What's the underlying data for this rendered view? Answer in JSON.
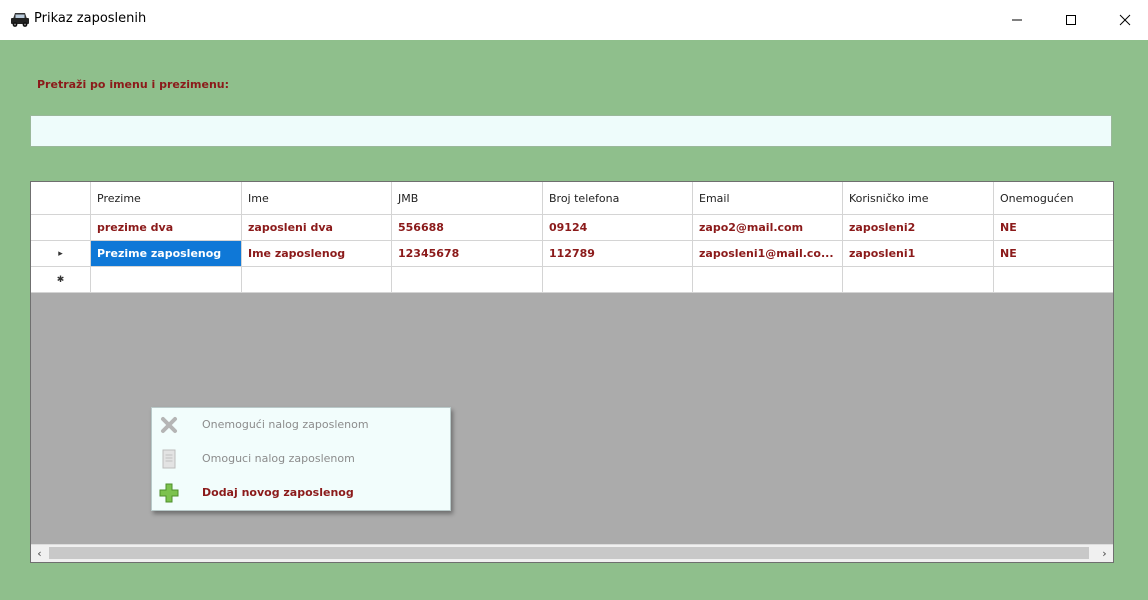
{
  "window": {
    "title": "Prikaz zaposlenih",
    "icon": "car-icon",
    "controls": [
      "minimize-icon",
      "maximize-icon",
      "close-icon"
    ]
  },
  "search": {
    "label": "Pretraži po imenu i prezimenu:",
    "value": "",
    "placeholder": ""
  },
  "grid": {
    "columns": [
      "Prezime",
      "Ime",
      "JMB",
      "Broj telefona",
      "Email",
      "Korisničko ime",
      "Onemogućen"
    ],
    "rows": [
      {
        "indicator": "",
        "cells": [
          "prezime dva",
          "zaposleni dva",
          "556688",
          "09124",
          "zapo2@mail.com",
          "zaposleni2",
          "NE"
        ]
      },
      {
        "indicator": "▸",
        "cells": [
          "Prezime zaposlenog",
          "Ime zaposlenog",
          "12345678",
          "112789",
          "zaposleni1@mail.co...",
          "zaposleni1",
          "NE"
        ]
      },
      {
        "indicator": "✱",
        "cells": [
          "",
          "",
          "",
          "",
          "",
          "",
          ""
        ]
      }
    ],
    "selected_cell": {
      "row": 1,
      "col": 0
    },
    "scroll_left_arrow": "‹",
    "scroll_right_arrow": "›"
  },
  "context_menu": {
    "items": [
      {
        "label": "Onemogući nalog zaposlenom",
        "icon": "x-icon",
        "enabled": false
      },
      {
        "label": "Omoguci nalog zaposlenom",
        "icon": "document-icon",
        "enabled": false
      },
      {
        "label": "Dodaj novog zaposlenog",
        "icon": "plus-icon",
        "enabled": true
      }
    ]
  },
  "colors": {
    "background": "#8fbf8c",
    "accent_text": "#8b1a1a",
    "selection": "#0f78d7",
    "input_bg": "#eefcfb",
    "grid_empty": "#ababab"
  }
}
